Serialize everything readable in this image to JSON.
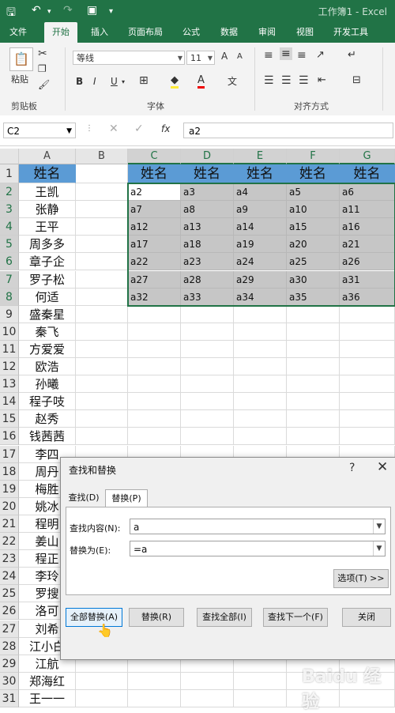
{
  "titlebar": {
    "title": "工作簿1 - Excel",
    "save_icon": "save-icon",
    "undo_icon": "undo-icon",
    "redo_icon": "redo-icon",
    "camera_icon": "camera-icon"
  },
  "tabs": [
    "文件",
    "开始",
    "插入",
    "页面布局",
    "公式",
    "数据",
    "审阅",
    "视图",
    "开发工具"
  ],
  "ribbon": {
    "paste_label": "粘贴",
    "clipboard_label": "剪贴板",
    "font_label": "字体",
    "align_label": "对齐方式",
    "font_name": "等线",
    "font_size": "11",
    "grow_font": "A",
    "shrink_font": "A",
    "bold": "B",
    "italic": "I",
    "underline": "U",
    "font_color_a": "A",
    "phonetic": "文"
  },
  "formula_bar": {
    "name_box": "C2",
    "fx": "fx",
    "value": "a2"
  },
  "columns": [
    "A",
    "B",
    "C",
    "D",
    "E",
    "F",
    "G"
  ],
  "rows": [
    "1",
    "2",
    "3",
    "4",
    "5",
    "6",
    "7",
    "8",
    "9",
    "10",
    "11",
    "12",
    "13",
    "14",
    "15",
    "16",
    "17",
    "18",
    "19",
    "20",
    "21",
    "22",
    "23",
    "24",
    "25",
    "26",
    "27",
    "28",
    "29",
    "30",
    "31"
  ],
  "column_a": [
    "姓名",
    "王凯",
    "张静",
    "王平",
    "周多多",
    "章子企",
    "罗子松",
    "何适",
    "盛秦星",
    "秦飞",
    "方爱爱",
    "欧浩",
    "孙曦",
    "程子吱",
    "赵秀",
    "钱茜茜",
    "李四",
    "周丹",
    "梅胜",
    "姚冰",
    "程明",
    "姜山",
    "程正",
    "李玲",
    "罗搜",
    "洛可",
    "刘希",
    "江小白",
    "江航",
    "郑海红",
    "王一一"
  ],
  "header_row": [
    "姓名",
    "姓名",
    "姓名",
    "姓名",
    "姓名"
  ],
  "data_rows": [
    [
      "a2",
      "a3",
      "a4",
      "a5",
      "a6"
    ],
    [
      "a7",
      "a8",
      "a9",
      "a10",
      "a11"
    ],
    [
      "a12",
      "a13",
      "a14",
      "a15",
      "a16"
    ],
    [
      "a17",
      "a18",
      "a19",
      "a20",
      "a21"
    ],
    [
      "a22",
      "a23",
      "a24",
      "a25",
      "a26"
    ],
    [
      "a27",
      "a28",
      "a29",
      "a30",
      "a31"
    ],
    [
      "a32",
      "a33",
      "a34",
      "a35",
      "a36"
    ]
  ],
  "dialog": {
    "title": "查找和替换",
    "help": "?",
    "close": "✕",
    "tab_find": "查找(D)",
    "tab_replace": "替换(P)",
    "find_label": "查找内容(N):",
    "find_value": "a",
    "replace_label": "替换为(E):",
    "replace_value": "=a",
    "options_button": "选项(T) >>",
    "replace_all_button": "全部替换(A)",
    "replace_button": "替换(R)",
    "find_all_button": "查找全部(I)",
    "find_next_button": "查找下一个(F)",
    "close_button": "关闭"
  },
  "watermark": "Baidu 经验"
}
